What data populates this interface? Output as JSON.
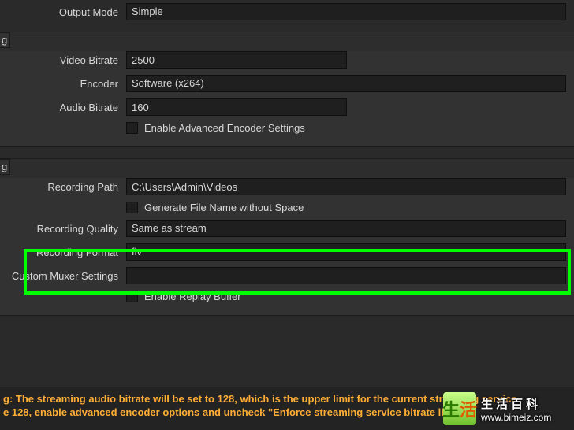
{
  "output": {
    "mode_label": "Output Mode",
    "mode_value": "Simple"
  },
  "streaming": {
    "tab_char": "g",
    "video_bitrate_label": "Video Bitrate",
    "video_bitrate_value": "2500",
    "encoder_label": "Encoder",
    "encoder_value": "Software (x264)",
    "audio_bitrate_label": "Audio Bitrate",
    "audio_bitrate_value": "160",
    "enable_adv_label": "Enable Advanced Encoder Settings"
  },
  "recording": {
    "tab_char": "g",
    "path_label": "Recording Path",
    "path_value": "C:\\Users\\Admin\\Videos",
    "gen_filename_label": "Generate File Name without Space",
    "quality_label": "Recording Quality",
    "quality_value": "Same as stream",
    "format_label": "Recording Format",
    "format_value": "flv",
    "muxer_label": "Custom Muxer Settings",
    "muxer_value": "",
    "replay_buffer_label": "Enable Replay Buffer"
  },
  "warning": {
    "line1": "g: The streaming audio bitrate will be set to 128, which is the upper limit for the current streaming service.",
    "line2": "e 128, enable advanced encoder options and uncheck \"Enforce streaming service bitrate limits\"."
  },
  "watermark": {
    "logo_left": "生",
    "logo_right": "活",
    "cn": "生活百科",
    "url": "www.bimeiz.com"
  }
}
